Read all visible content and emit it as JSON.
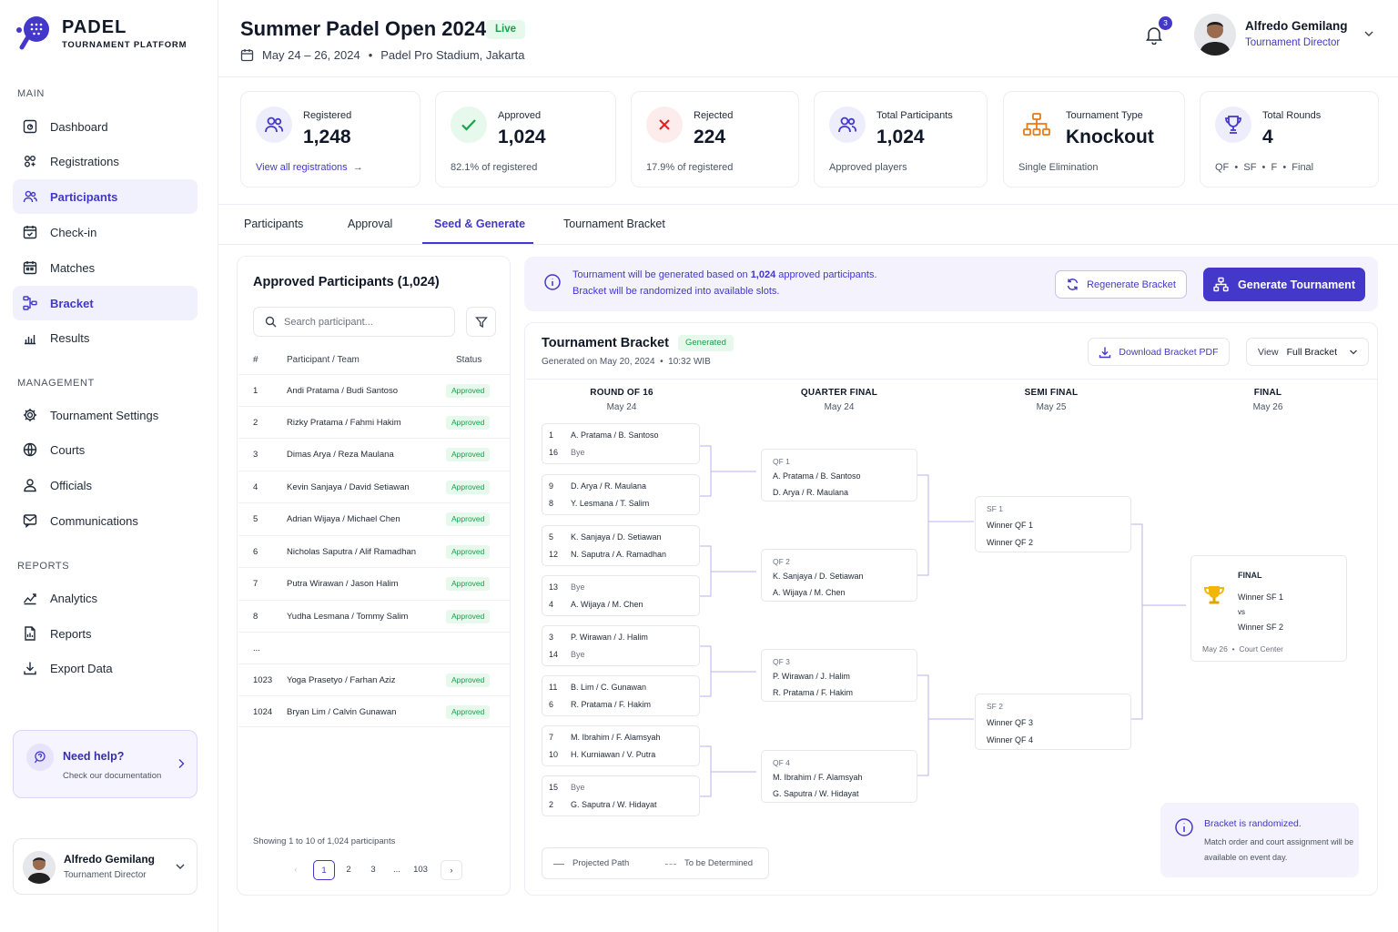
{
  "sidebar": {
    "logo": {
      "title": "PADEL",
      "subtitle": "TOURNAMENT PLATFORM"
    },
    "sections": {
      "main": "MAIN",
      "management": "MANAGEMENT",
      "reports": "REPORTS"
    },
    "main_items": [
      {
        "label": "Dashboard",
        "icon": "dashboard-icon"
      },
      {
        "label": "Registrations",
        "icon": "registrations-icon"
      },
      {
        "label": "Participants",
        "icon": "users-icon",
        "active": true
      },
      {
        "label": "Check-in",
        "icon": "calendar-check-icon"
      },
      {
        "label": "Matches",
        "icon": "calendar-icon"
      },
      {
        "label": "Bracket",
        "icon": "bracket-icon",
        "active": true
      },
      {
        "label": "Results",
        "icon": "bar-chart-icon"
      }
    ],
    "management_items": [
      {
        "label": "Tournament Settings",
        "icon": "gear-icon"
      },
      {
        "label": "Courts",
        "icon": "globe-icon"
      },
      {
        "label": "Officials",
        "icon": "user-icon"
      },
      {
        "label": "Communications",
        "icon": "message-icon"
      }
    ],
    "reports_items": [
      {
        "label": "Analytics",
        "icon": "analytics-icon"
      },
      {
        "label": "Reports",
        "icon": "document-icon"
      },
      {
        "label": "Export Data",
        "icon": "download-icon"
      }
    ],
    "help": {
      "title": "Need help?",
      "subtitle": "Check our documentation"
    },
    "user": {
      "name": "Alfredo Gemilang",
      "role": "Tournament Director"
    }
  },
  "header": {
    "title": "Summer Padel Open 2024",
    "status": "Live",
    "dates": "May 24 – 26, 2024",
    "venue": "Padel Pro Stadium, Jakarta",
    "notifications": "3",
    "user": {
      "name": "Alfredo Gemilang",
      "role": "Tournament Director"
    }
  },
  "stats": [
    {
      "label": "Registered",
      "value": "1,248",
      "footer": "View all registrations",
      "icon": "users-icon",
      "color": "#4338ca"
    },
    {
      "label": "Approved",
      "value": "1,024",
      "footer": "82.1% of registered",
      "icon": "check-icon",
      "color": "#16a34a"
    },
    {
      "label": "Rejected",
      "value": "224",
      "footer": "17.9% of registered",
      "icon": "x-icon",
      "color": "#dc2626"
    },
    {
      "label": "Total Participants",
      "value": "1,024",
      "footer": "Approved players",
      "icon": "users-icon",
      "color": "#4338ca"
    },
    {
      "label": "Tournament Type",
      "value": "Knockout",
      "footer": "Single Elimination",
      "icon": "hierarchy-icon",
      "color": "#ea7a12"
    },
    {
      "label": "Total Rounds",
      "value": "4",
      "footer": "QF  •  SF  •  F  •  Final",
      "icon": "trophy-icon",
      "color": "#4338ca"
    }
  ],
  "tabs": [
    "Participants",
    "Approval",
    "Seed & Generate",
    "Tournament Bracket"
  ],
  "participants_panel": {
    "title": "Approved Participants (1,024)",
    "search_placeholder": "Search participant...",
    "headers": {
      "num": "#",
      "team": "Participant / Team",
      "status": "Status"
    },
    "rows": [
      {
        "n": "1",
        "team": "Andi Pratama / Budi Santoso",
        "status": "Approved"
      },
      {
        "n": "2",
        "team": "Rizky Pratama / Fahmi Hakim",
        "status": "Approved"
      },
      {
        "n": "3",
        "team": "Dimas Arya / Reza Maulana",
        "status": "Approved"
      },
      {
        "n": "4",
        "team": "Kevin Sanjaya / David Setiawan",
        "status": "Approved"
      },
      {
        "n": "5",
        "team": "Adrian Wijaya / Michael Chen",
        "status": "Approved"
      },
      {
        "n": "6",
        "team": "Nicholas Saputra / Alif Ramadhan",
        "status": "Approved"
      },
      {
        "n": "7",
        "team": "Putra Wirawan / Jason Halim",
        "status": "Approved"
      },
      {
        "n": "8",
        "team": "Yudha Lesmana / Tommy Salim",
        "status": "Approved"
      },
      {
        "n": "...",
        "team": "",
        "status": ""
      },
      {
        "n": "1023",
        "team": "Yoga Prasetyo / Farhan Aziz",
        "status": "Approved"
      },
      {
        "n": "1024",
        "team": "Bryan Lim / Calvin Gunawan",
        "status": "Approved"
      }
    ],
    "showing": "Showing 1 to 10 of 1,024 participants",
    "pages": [
      "1",
      "2",
      "3",
      "...",
      "103"
    ]
  },
  "info_bar": {
    "line1_pre": "Tournament will be generated based on ",
    "line1_bold": "1,024",
    "line1_post": " approved participants.",
    "line2": "Bracket will be randomized into available slots.",
    "regen": "Regenerate Bracket",
    "generate": "Generate Tournament"
  },
  "bracket": {
    "title": "Tournament Bracket",
    "badge": "Generated",
    "generated_on": "Generated on May 20, 2024",
    "generated_time": "10:32 WIB",
    "download": "Download Bracket PDF",
    "view_label": "View",
    "view_value": "Full Bracket",
    "rounds": [
      {
        "name": "ROUND OF 16",
        "date": "May 24"
      },
      {
        "name": "QUARTER FINAL",
        "date": "May 24"
      },
      {
        "name": "SEMI FINAL",
        "date": "May 25"
      },
      {
        "name": "FINAL",
        "date": "May 26"
      }
    ],
    "r16": [
      {
        "s1": "1",
        "t1": "A. Pratama / B. Santoso",
        "s2": "16",
        "t2": "Bye"
      },
      {
        "s1": "9",
        "t1": "D. Arya / R. Maulana",
        "s2": "8",
        "t2": "Y. Lesmana / T. Salim"
      },
      {
        "s1": "5",
        "t1": "K. Sanjaya / D. Setiawan",
        "s2": "12",
        "t2": "N. Saputra / A. Ramadhan"
      },
      {
        "s1": "13",
        "t1": "Bye",
        "s2": "4",
        "t2": "A. Wijaya / M. Chen"
      },
      {
        "s1": "3",
        "t1": "P. Wirawan / J. Halim",
        "s2": "14",
        "t2": "Bye"
      },
      {
        "s1": "11",
        "t1": "B. Lim / C. Gunawan",
        "s2": "6",
        "t2": "R. Pratama / F. Hakim"
      },
      {
        "s1": "7",
        "t1": "M. Ibrahim / F. Alamsyah",
        "s2": "10",
        "t2": "H. Kurniawan / V. Putra"
      },
      {
        "s1": "15",
        "t1": "Bye",
        "s2": "2",
        "t2": "G. Saputra / W. Hidayat"
      }
    ],
    "qf": [
      {
        "label": "QF 1",
        "a": "A. Pratama / B. Santoso",
        "b": "D. Arya / R. Maulana"
      },
      {
        "label": "QF 2",
        "a": "K. Sanjaya / D. Setiawan",
        "b": "A. Wijaya / M. Chen"
      },
      {
        "label": "QF 3",
        "a": "P. Wirawan / J. Halim",
        "b": "R. Pratama / F. Hakim"
      },
      {
        "label": "QF 4",
        "a": "M. Ibrahim / F. Alamsyah",
        "b": "G. Saputra / W. Hidayat"
      }
    ],
    "sf": [
      {
        "label": "SF 1",
        "a": "Winner QF 1",
        "b": "Winner QF 2"
      },
      {
        "label": "SF 2",
        "a": "Winner QF 3",
        "b": "Winner QF 4"
      }
    ],
    "final": {
      "label": "FINAL",
      "a": "Winner SF 1",
      "vs": "vs",
      "b": "Winner SF 2",
      "date": "May 26",
      "court": "Court Center"
    },
    "legend": {
      "projected": "Projected Path",
      "tbd": "To be Determined"
    },
    "note": {
      "title": "Bracket is randomized.",
      "text": "Match order and court assignment will be available on event day."
    }
  }
}
